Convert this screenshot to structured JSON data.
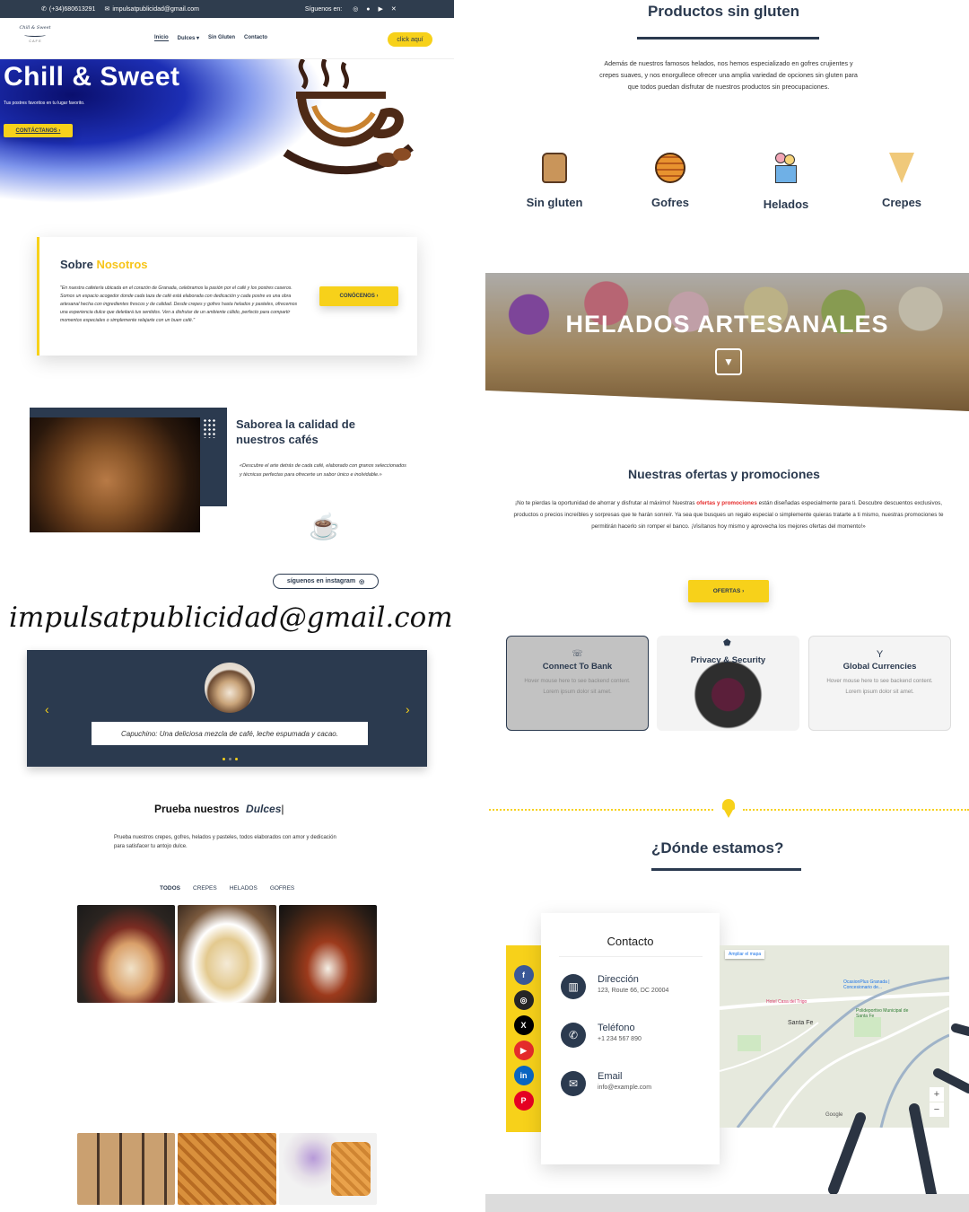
{
  "topbar": {
    "phone": "(+34)680613291",
    "email": "impulsatpublicidad@gmail.com",
    "follow_label": "Síguenos en:"
  },
  "nav": {
    "logo_text": "Chill & Sweet",
    "logo_sub": "C A F E",
    "items": [
      "Inicio",
      "Dulces ▾",
      "Sin Gluten",
      "Contacto"
    ],
    "cta": "click aquí"
  },
  "hero": {
    "title": "Chill & Sweet",
    "subtitle": "Tus postres favoritos en tu lugar favorito.",
    "button": "CONTÁCTANOS ›"
  },
  "about": {
    "title_a": "Sobre",
    "title_b": "Nosotros",
    "text": "\"En nuestra cafetería ubicada en el corazón de Granada, celebramos la pasión por el café y los postres caseros. Somos un espacio acogedor donde cada taza de café está elaborada con dedicación y cada postre es una obra artesanal hecha con ingredientes frescos y de calidad. Desde crepes y gofres hasta helados y pasteles, ofrecemos una experiencia dulce que deleitará tus sentidos. Ven a disfrutar de un ambiente cálido, perfecto para compartir momentos especiales o simplemente relajarte con un buen café.\"",
    "button": "CONÓCENOS ›"
  },
  "coffee": {
    "title": "Saborea la calidad de nuestros cafés",
    "text": "«Descubre el arte detrás de cada café, elaborado con granos seleccionados y técnicas perfectas para ofrecerte un sabor único e inolvidable.»",
    "instagram_btn": "síguenos en instagram"
  },
  "email_overlay": "impulsatpublicidad@gmail.com",
  "carousel": {
    "caption": "Capuchino: Una deliciosa mezcla de café, leche espumada y cacao."
  },
  "dulces": {
    "title_a": "Prueba nuestros",
    "title_b": "Dulces",
    "text": "Prueba nuestros crepes, gofres, helados y pasteles, todos elaborados con amor y dedicación para satisfacer tu antojo dulce.",
    "filters": [
      "TODOS",
      "CREPES",
      "HELADOS",
      "GOFRES"
    ]
  },
  "gluten": {
    "title": "Productos sin gluten",
    "text": "Además de nuestros famosos helados, nos hemos especializado en gofres crujientes y crepes suaves, y nos enorgullece ofrecer una amplia variedad de opciones sin gluten para que todos puedan disfrutar de nuestros productos sin preocupaciones.",
    "items": [
      "Sin gluten",
      "Gofres",
      "Helados",
      "Crepes"
    ]
  },
  "helados_banner": "HELADOS ARTESANALES",
  "ofertas": {
    "title": "Nuestras ofertas y promociones",
    "text_a": "¡No te pierdas la oportunidad de ahorrar y disfrutar al máximo! Nuestras ",
    "text_hl": "ofertas y promociones",
    "text_b": " están diseñadas especialmente para ti. Descubre descuentos exclusivos, productos o precios increíbles y sorpresas que te harán sonreír. Ya sea que busques un regalo especial o simplemente quieras tratarte a ti mismo, nuestras promociones te permitirán hacerlo sin romper el banco. ¡Visítanos hoy mismo y aprovecha los mejores ofertas del momento!»",
    "button": "OFERTAS ›"
  },
  "features": [
    {
      "title": "Connect To Bank",
      "text": "Hover mouse here to see backend content. Lorem ipsum dolor sit amet."
    },
    {
      "title": "Privacy & Security",
      "text": ""
    },
    {
      "title": "Global Currencies",
      "text": "Hover mouse here to see backend content. Lorem ipsum dolor sit amet."
    }
  ],
  "location": {
    "title": "¿Dónde estamos?",
    "contact_title": "Contacto",
    "entries": [
      {
        "label": "Dirección",
        "value": "123, Route 66, DC 20004"
      },
      {
        "label": "Teléfono",
        "value": "+1 234 567 890"
      },
      {
        "label": "Email",
        "value": "info@example.com"
      }
    ],
    "map_labels": [
      "Ampliar el mapa",
      "Santa Fe",
      "OcasionPlus Granada | Concesionario de...",
      "Hotel Casa del Trigo",
      "Polideportivo Municipal de Santa Fe",
      "Google"
    ]
  },
  "colors": {
    "navy": "#2b3a4f",
    "yellow": "#f7d11a",
    "red": "#e52b2b"
  }
}
